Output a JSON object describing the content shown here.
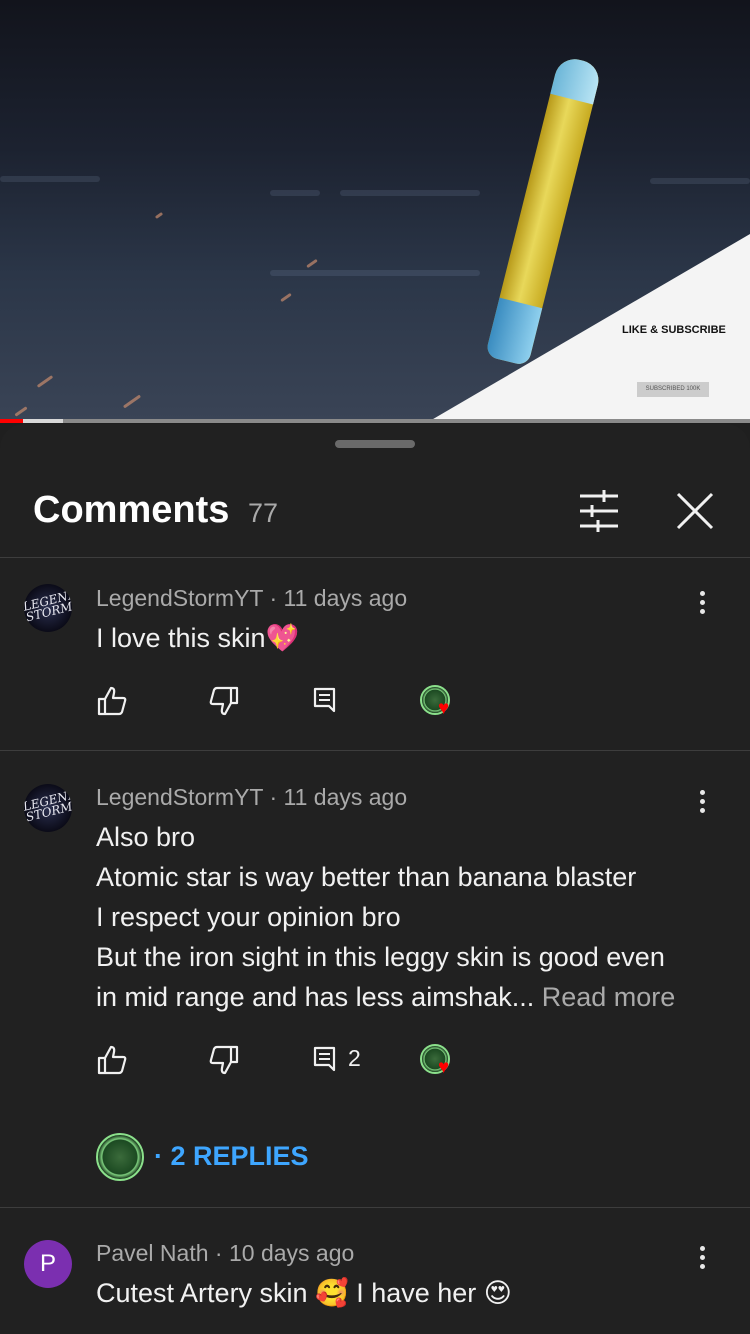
{
  "video": {
    "overlay_text": "LIKE & SUBSCRIBE",
    "subscribed_label": "SUBSCRIBED 100K",
    "progress_fraction": 0.03
  },
  "header": {
    "title": "Comments",
    "count": "77"
  },
  "comments": [
    {
      "avatar_text": "LEGEND STORM",
      "author": "LegendStormYT",
      "time": "11 days ago",
      "lines": [
        "I love this skin💖"
      ],
      "more_label": "",
      "reply_count": "",
      "creator_heart": true
    },
    {
      "avatar_text": "LEGEND STORM",
      "author": "LegendStormYT",
      "time": "11 days ago",
      "lines": [
        "Also bro",
        "Atomic star is way better than banana blaster",
        "I respect your opinion bro",
        "But the iron sight in this leggy skin is good even",
        "in mid range and has less aimshak..."
      ],
      "more_label": "Read more",
      "reply_count": "2",
      "creator_heart": true,
      "replies_label": "2 REPLIES"
    },
    {
      "avatar_text": "P",
      "author": "Pavel Nath",
      "time": "10 days ago",
      "lines": [
        "Cutest Artery skin 🥰 I have her 😍"
      ],
      "more_label": "",
      "reply_count": "",
      "creator_heart": false
    }
  ],
  "icons": {
    "like": "thumbs-up-icon",
    "dislike": "thumbs-down-icon",
    "reply": "comment-icon",
    "filter": "sliders-icon",
    "close": "close-icon",
    "more": "more-vertical-icon"
  },
  "colors": {
    "background": "#212121",
    "accent_link": "#3ea6ff",
    "progress_played": "#ff0000",
    "avatar_p": "#7b2fb0",
    "heart": "#ff0000"
  }
}
